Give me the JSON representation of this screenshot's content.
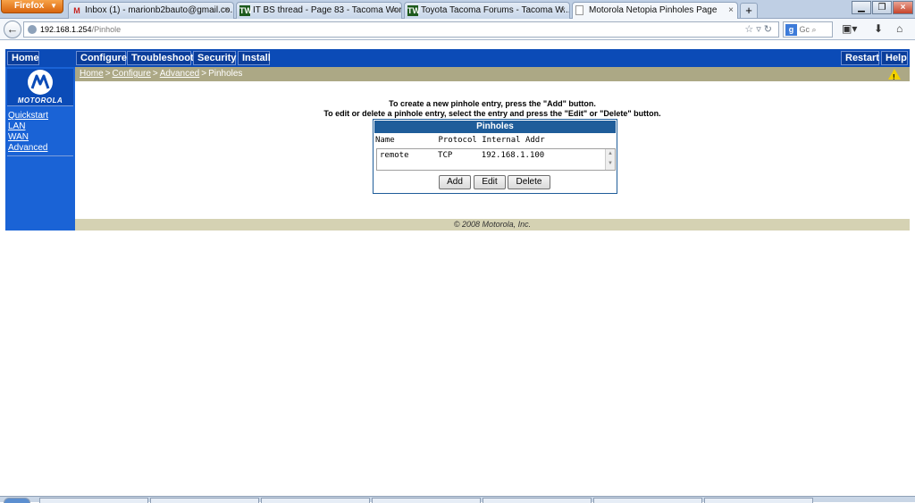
{
  "browser": {
    "app_button": "Firefox",
    "tabs": [
      {
        "title": "Inbox (1) - marionb2bauto@gmail.co...",
        "icon": "gmail-icon"
      },
      {
        "title": "IT BS thread - Page 83 - Tacoma Worl...",
        "icon": "tw-icon"
      },
      {
        "title": "Toyota Tacoma Forums - Tacoma W...",
        "icon": "tw-icon"
      },
      {
        "title": "Motorola Netopia Pinholes Page",
        "icon": "page-icon"
      }
    ],
    "url_host": "192.168.1.254",
    "url_path": "/Pinhole",
    "search_placeholder": "Gc"
  },
  "router": {
    "top_nav": {
      "home": "Home",
      "configure": "Configure",
      "troubleshoot": "Troubleshoot",
      "security": "Security",
      "install": "Install",
      "restart": "Restart",
      "help": "Help"
    },
    "logo_text": "MOTOROLA",
    "sidebar": [
      "Quickstart",
      "LAN",
      "WAN",
      "Advanced"
    ],
    "breadcrumb": [
      "Home",
      "Configure",
      "Advanced",
      "Pinholes"
    ],
    "breadcrumb_sep": ">",
    "instruction_1": "To create a new pinhole entry, press the \"Add\" button.",
    "instruction_2": "To edit or delete a pinhole entry, select the entry and press the \"Edit\" or \"Delete\" button.",
    "pinholes": {
      "title": "Pinholes",
      "header": "Name         Protocol Internal Addr",
      "rows": [
        "remote      TCP      192.168.1.100"
      ],
      "buttons": {
        "add": "Add",
        "edit": "Edit",
        "delete": "Delete"
      }
    },
    "footer": "© 2008 Motorola, Inc."
  }
}
